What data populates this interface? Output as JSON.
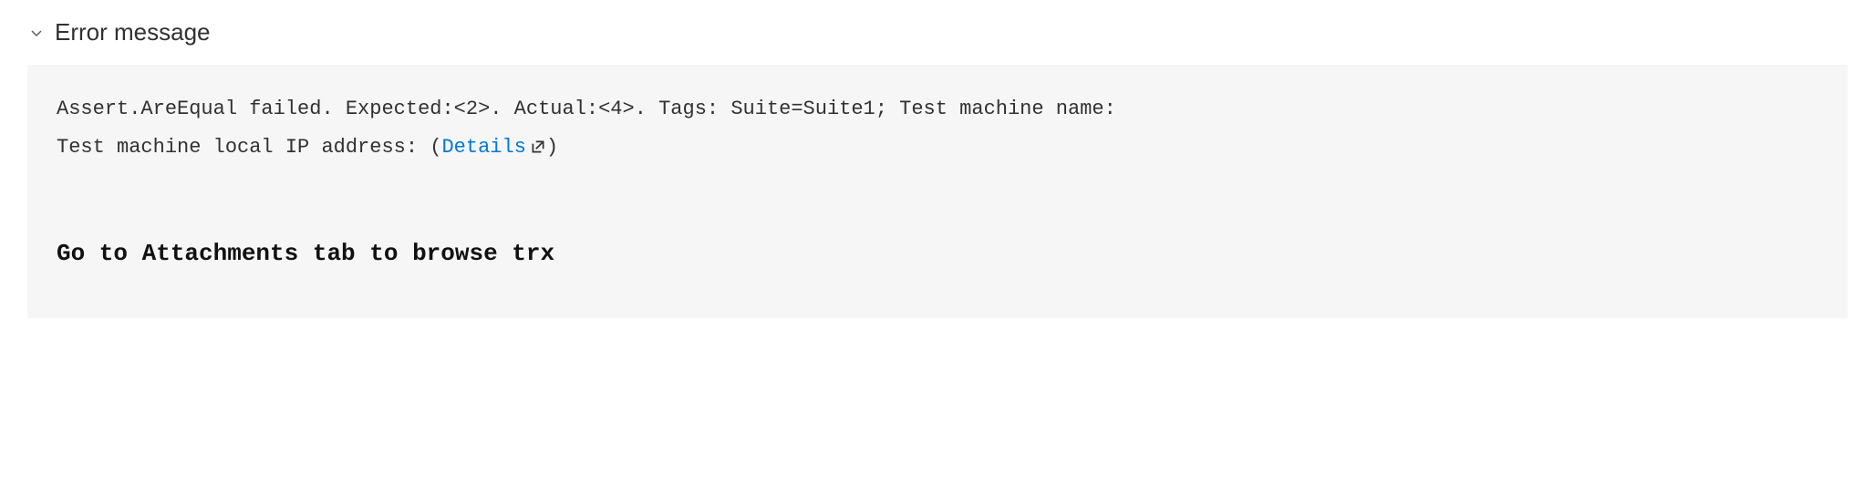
{
  "section": {
    "title": "Error message",
    "expanded": true
  },
  "error": {
    "message_line1": "Assert.AreEqual failed. Expected:<2>. Actual:<4>. Tags: Suite=Suite1; Test machine name:",
    "message_line2_prefix": "Test machine local IP address: ",
    "details_paren_open": "(",
    "details_label": "Details",
    "details_paren_close": ")",
    "attachments_hint": "Go to Attachments tab to browse trx"
  }
}
